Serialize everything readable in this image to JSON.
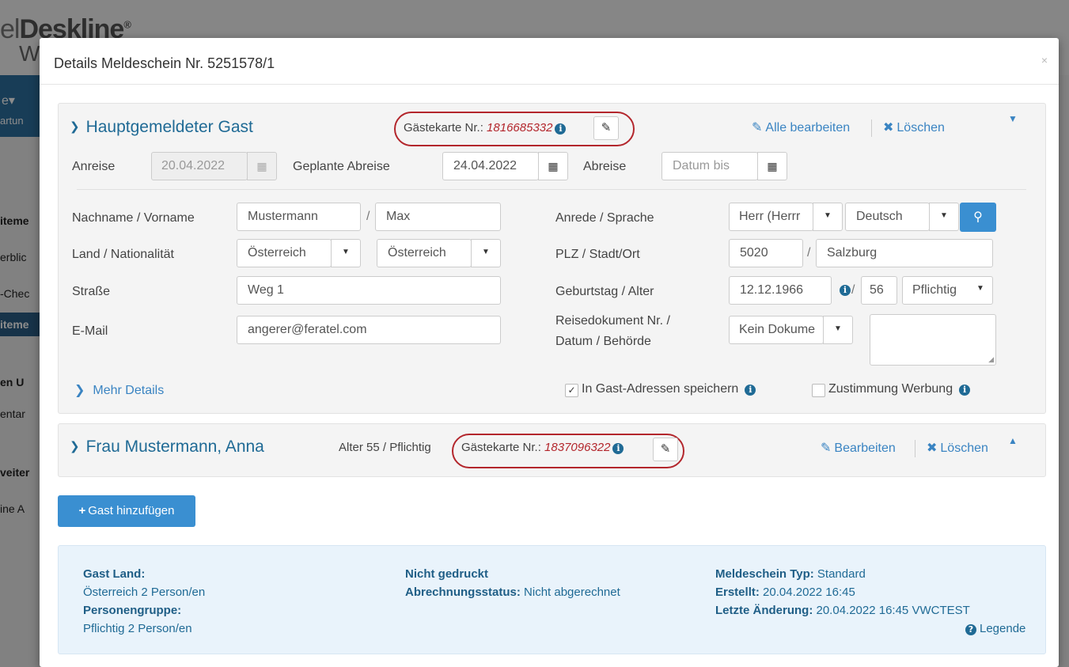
{
  "background": {
    "logo_prefix": "el",
    "logo_main": "Deskline",
    "logo_mark": "®",
    "logo_line2": "W",
    "sidebar_items": [
      "e▾",
      "artun",
      "iteme",
      "erblic",
      "-Chec",
      "iteme",
      "en U",
      "entar",
      "veiter",
      "ine A"
    ]
  },
  "modal": {
    "title": "Details Meldeschein Nr. 5251578/1",
    "close": "×"
  },
  "main_guest": {
    "title": "Hauptgemeldeter Gast",
    "card_label": "Gästekarte Nr.:",
    "card_number": "1816685332",
    "edit_all": "Alle bearbeiten",
    "delete": "Löschen",
    "arrival_label": "Anreise",
    "arrival_value": "20.04.2022",
    "planned_departure_label": "Geplante Abreise",
    "planned_departure_value": "24.04.2022",
    "departure_label": "Abreise",
    "departure_placeholder": "Datum bis",
    "name_label": "Nachname / Vorname",
    "last_name": "Mustermann",
    "first_name": "Max",
    "country_label": "Land / Nationalität",
    "country": "Österreich",
    "nationality": "Österreich",
    "street_label": "Straße",
    "street": "Weg 1",
    "email_label": "E-Mail",
    "email": "angerer@feratel.com",
    "salutation_label": "Anrede / Sprache",
    "salutation": "Herr (Herrr",
    "language": "Deutsch",
    "zip_label": "PLZ / Stadt/Ort",
    "zip": "5020",
    "city": "Salzburg",
    "birthday_label": "Geburtstag / Alter",
    "birthday": "12.12.1966",
    "age": "56",
    "category": "Pflichtig",
    "document_label_1": "Reisedokument Nr. /",
    "document_label_2": "Datum / Behörde",
    "document": "Kein Dokume",
    "more_details": "Mehr Details",
    "save_address_label": "In Gast-Adressen speichern",
    "save_address_checked": true,
    "consent_label": "Zustimmung Werbung",
    "consent_checked": false
  },
  "second_guest": {
    "title": "Frau Mustermann, Anna",
    "meta": "Alter 55 / Pflichtig",
    "card_label": "Gästekarte Nr.:",
    "card_number": "1837096322",
    "edit": "Bearbeiten",
    "delete": "Löschen"
  },
  "add_guest_button": "Gast hinzufügen",
  "summary": {
    "guest_country_label": "Gast Land:",
    "guest_country_value": "Österreich 2 Person/en",
    "person_group_label": "Personengruppe:",
    "person_group_value": "Pflichtig 2 Person/en",
    "print_status": "Nicht gedruckt",
    "billing_label": "Abrechnungsstatus:",
    "billing_value": "Nicht abgerechnet",
    "type_label": "Meldeschein Typ:",
    "type_value": "Standard",
    "created_label": "Erstellt:",
    "created_value": "20.04.2022 16:45",
    "changed_label": "Letzte Änderung:",
    "changed_value": "20.04.2022 16:45 VWCTEST",
    "legend": "Legende"
  },
  "colors": {
    "accent": "#3a8fd1",
    "title_blue": "#1f6a95",
    "highlight_red": "#b3262c"
  }
}
